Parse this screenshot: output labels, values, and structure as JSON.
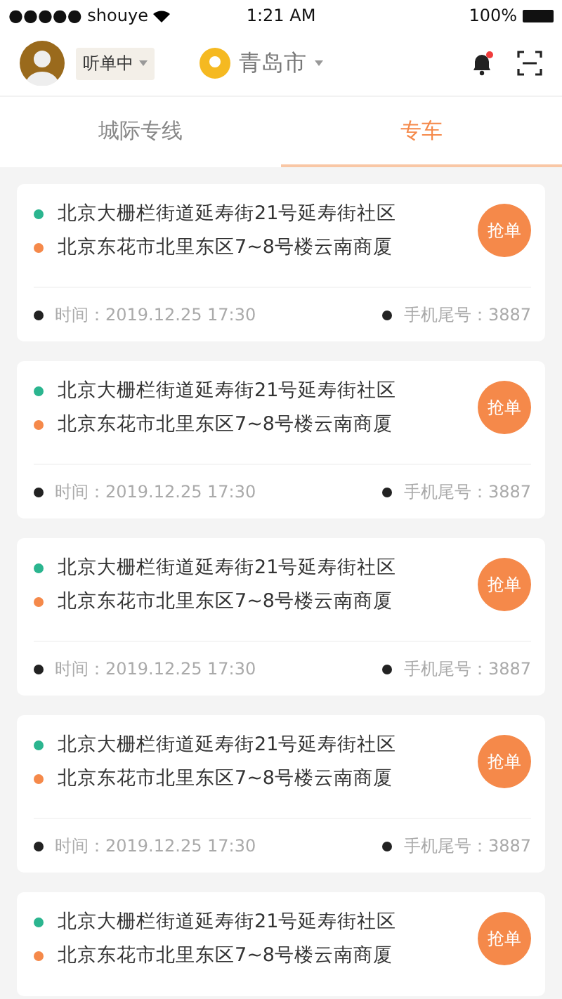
{
  "status_bar": {
    "carrier": "●●●●● shouye",
    "time": "1:21 AM",
    "battery": "100%"
  },
  "header": {
    "status": "听单中",
    "city": "青岛市",
    "notification": true
  },
  "tabs": [
    {
      "label": "城际专线",
      "selected": false
    },
    {
      "label": "专车",
      "selected": true
    }
  ],
  "orders": [
    {
      "from": "北京大栅栏街道延寿街21号延寿街社区",
      "to": "北京东花市北里东区7~8号楼云南商厦",
      "button": "抢单",
      "time": "时间：2019.12.25 17:30",
      "phone": "手机尾号：3887"
    },
    {
      "from": "北京大栅栏街道延寿街21号延寿街社区",
      "to": "北京东花市北里东区7~8号楼云南商厦",
      "button": "抢单",
      "time": "时间：2019.12.25 17:30",
      "phone": "手机尾号：3887"
    },
    {
      "from": "北京大栅栏街道延寿街21号延寿街社区",
      "to": "北京东花市北里东区7~8号楼云南商厦",
      "button": "抢单",
      "time": "时间：2019.12.25 17:30",
      "phone": "手机尾号：3887"
    },
    {
      "from": "北京大栅栏街道延寿街21号延寿街社区",
      "to": "北京东花市北里东区7~8号楼云南商厦",
      "button": "抢单",
      "time": "时间：2019.12.25 17:30",
      "phone": "手机尾号：3887"
    },
    {
      "from": "北京大栅栏街道延寿街21号延寿街社区",
      "to": "北京东花市北里东区7~8号楼云南商厦",
      "button": "抢单"
    }
  ]
}
